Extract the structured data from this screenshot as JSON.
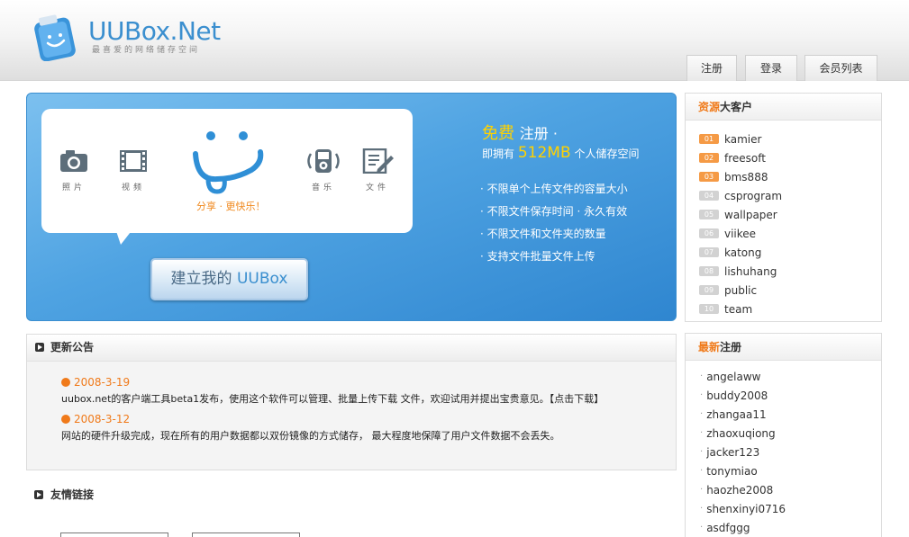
{
  "header": {
    "logo_text": "UUBox.Net",
    "logo_tagline": "最喜爱的网络储存空间",
    "nav": [
      {
        "label": "注册"
      },
      {
        "label": "登录"
      },
      {
        "label": "会员列表"
      }
    ]
  },
  "banner": {
    "features": [
      {
        "icon": "camera-icon",
        "label": "照片"
      },
      {
        "icon": "film-icon",
        "label": "视频"
      },
      {
        "icon": "music-player-icon",
        "label": "音乐"
      },
      {
        "icon": "document-edit-icon",
        "label": "文件"
      }
    ],
    "smile_caption": "分享 · 更快乐！",
    "cta_prefix": "建立我的 ",
    "cta_brand": "UUBox",
    "free_label": "免费",
    "register_label": "注册 ·",
    "storage_prefix": "即拥有",
    "storage_amount": "512MB",
    "storage_suffix": "个人储存空间",
    "bullets": [
      "· 不限单个上传文件的容量大小",
      "· 不限文件保存时间 · 永久有效",
      "· 不限文件和文件夹的数量",
      "· 支持文件批量文件上传"
    ]
  },
  "announcements": {
    "title": "更新公告",
    "items": [
      {
        "date": "2008-3-19",
        "text": "uubox.net的客户端工具beta1发布，使用这个软件可以管理、批量上传下载 文件，欢迎试用并提出宝贵意见。【点击下载】"
      },
      {
        "date": "2008-3-12",
        "text": "网站的硬件升级完成，现在所有的用户数据都以双份镜像的方式储存， 最大程度地保障了用户文件数据不会丢失。"
      }
    ]
  },
  "friend_links": {
    "title": "友情链接"
  },
  "top_customers": {
    "title_highlight": "资源",
    "title_rest": "大客户",
    "items": [
      {
        "rank": "01",
        "name": "kamier"
      },
      {
        "rank": "02",
        "name": "freesoft"
      },
      {
        "rank": "03",
        "name": "bms888"
      },
      {
        "rank": "04",
        "name": "csprogram"
      },
      {
        "rank": "05",
        "name": "wallpaper"
      },
      {
        "rank": "06",
        "name": "viikee"
      },
      {
        "rank": "07",
        "name": "katong"
      },
      {
        "rank": "08",
        "name": "lishuhang"
      },
      {
        "rank": "09",
        "name": "public"
      },
      {
        "rank": "10",
        "name": "team"
      }
    ],
    "colors": {
      "top3": "#f59a45",
      "rest": "#d2d2d2"
    }
  },
  "newest": {
    "title_highlight": "最新",
    "title_rest": "注册",
    "items": [
      "angelaww",
      "buddy2008",
      "zhangaa11",
      "zhaoxuqiong",
      "jacker123",
      "tonymiao",
      "haozhe2008",
      "shenxinyi0716",
      "asdfggg"
    ]
  }
}
